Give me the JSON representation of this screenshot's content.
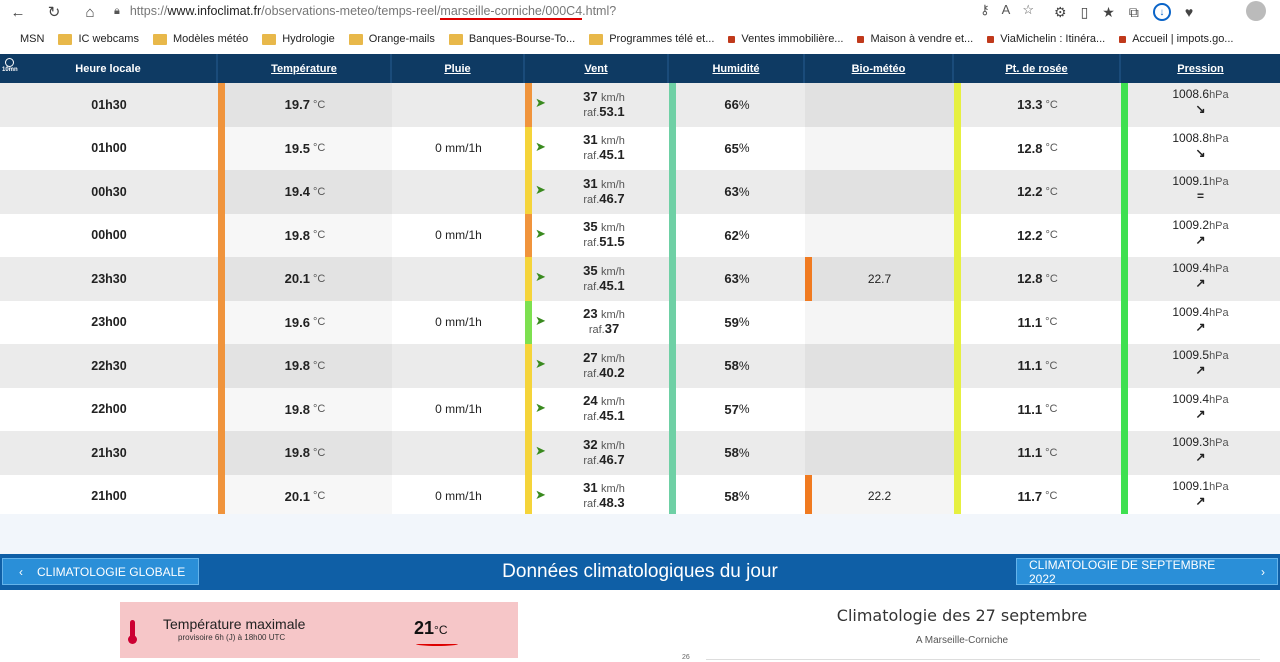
{
  "browser": {
    "url_prefix": "https://",
    "url_domain": "www.infoclimat.fr",
    "url_path": "/observations-meteo/temps-reel/",
    "url_highlight": "marseille-corniche/000C4",
    "url_suffix": ".html?"
  },
  "bookmarks": [
    {
      "label": "MSN",
      "icon": "msn-icon"
    },
    {
      "label": "IC webcams",
      "icon": "folder-icon"
    },
    {
      "label": "Modèles météo",
      "icon": "folder-icon"
    },
    {
      "label": "Hydrologie",
      "icon": "folder-icon"
    },
    {
      "label": "Orange-mails",
      "icon": "folder-icon"
    },
    {
      "label": "Banques-Bourse-To...",
      "icon": "folder-icon"
    },
    {
      "label": "Programmes télé et...",
      "icon": "folder-icon"
    },
    {
      "label": "Ventes immobilière...",
      "icon": "site-icon"
    },
    {
      "label": "Maison à vendre et...",
      "icon": "site-icon"
    },
    {
      "label": "ViaMichelin : Itinéra...",
      "icon": "site-icon"
    },
    {
      "label": "Accueil | impots.go...",
      "icon": "site-icon"
    }
  ],
  "table": {
    "interval_label": "10mn",
    "headers": {
      "time": "Heure locale",
      "temp": "Température",
      "rain": "Pluie",
      "wind": "Vent",
      "hum": "Humidité",
      "bio": "Bio-météo",
      "dew": "Pt. de rosée",
      "pres": "Pression"
    },
    "units": {
      "temp": "°C",
      "wind": "km/h",
      "pres": "hPa",
      "gust_prefix": "raf."
    },
    "rows": [
      {
        "time": "01h30",
        "temp": "19.7",
        "rain": "",
        "wind": "37",
        "gust": "53.1",
        "hum": "66",
        "bio": "",
        "dew": "13.3",
        "pres": "1008.6",
        "trend": "↘",
        "temp_color": "#f0943c",
        "wind_color": "#f0943c",
        "hum_color": "#6fd0a5",
        "bio_color": "",
        "dew_color": "#e6f040",
        "pres_color": "#3ee050"
      },
      {
        "time": "01h00",
        "temp": "19.5",
        "rain": "0 mm/1h",
        "wind": "31",
        "gust": "45.1",
        "hum": "65",
        "bio": "",
        "dew": "12.8",
        "pres": "1008.8",
        "trend": "↘",
        "temp_color": "#f0943c",
        "wind_color": "#f5d43a",
        "hum_color": "#6fd0a5",
        "bio_color": "",
        "dew_color": "#e6f040",
        "pres_color": "#3ee050"
      },
      {
        "time": "00h30",
        "temp": "19.4",
        "rain": "",
        "wind": "31",
        "gust": "46.7",
        "hum": "63",
        "bio": "",
        "dew": "12.2",
        "pres": "1009.1",
        "trend": "=",
        "temp_color": "#f0943c",
        "wind_color": "#f5d43a",
        "hum_color": "#6fd0a5",
        "bio_color": "",
        "dew_color": "#e6f040",
        "pres_color": "#3ee050"
      },
      {
        "time": "00h00",
        "temp": "19.8",
        "rain": "0 mm/1h",
        "wind": "35",
        "gust": "51.5",
        "hum": "62",
        "bio": "",
        "dew": "12.2",
        "pres": "1009.2",
        "trend": "↗",
        "temp_color": "#f0943c",
        "wind_color": "#f0943c",
        "hum_color": "#6fd0a5",
        "bio_color": "",
        "dew_color": "#e6f040",
        "pres_color": "#3ee050"
      },
      {
        "time": "23h30",
        "temp": "20.1",
        "rain": "",
        "wind": "35",
        "gust": "45.1",
        "hum": "63",
        "bio": "22.7",
        "dew": "12.8",
        "pres": "1009.4",
        "trend": "↗",
        "temp_color": "#f0943c",
        "wind_color": "#f5d43a",
        "hum_color": "#6fd0a5",
        "bio_color": "#f07a20",
        "dew_color": "#e6f040",
        "pres_color": "#3ee050"
      },
      {
        "time": "23h00",
        "temp": "19.6",
        "rain": "0 mm/1h",
        "wind": "23",
        "gust": "37",
        "hum": "59",
        "bio": "",
        "dew": "11.1",
        "pres": "1009.4",
        "trend": "↗",
        "temp_color": "#f0943c",
        "wind_color": "#7de050",
        "hum_color": "#6fd0a5",
        "bio_color": "",
        "dew_color": "#e6f040",
        "pres_color": "#3ee050"
      },
      {
        "time": "22h30",
        "temp": "19.8",
        "rain": "",
        "wind": "27",
        "gust": "40.2",
        "hum": "58",
        "bio": "",
        "dew": "11.1",
        "pres": "1009.5",
        "trend": "↗",
        "temp_color": "#f0943c",
        "wind_color": "#f5d43a",
        "hum_color": "#6fd0a5",
        "bio_color": "",
        "dew_color": "#e6f040",
        "pres_color": "#3ee050"
      },
      {
        "time": "22h00",
        "temp": "19.8",
        "rain": "0 mm/1h",
        "wind": "24",
        "gust": "45.1",
        "hum": "57",
        "bio": "",
        "dew": "11.1",
        "pres": "1009.4",
        "trend": "↗",
        "temp_color": "#f0943c",
        "wind_color": "#f5d43a",
        "hum_color": "#6fd0a5",
        "bio_color": "",
        "dew_color": "#e6f040",
        "pres_color": "#3ee050"
      },
      {
        "time": "21h30",
        "temp": "19.8",
        "rain": "",
        "wind": "32",
        "gust": "46.7",
        "hum": "58",
        "bio": "",
        "dew": "11.1",
        "pres": "1009.3",
        "trend": "↗",
        "temp_color": "#f0943c",
        "wind_color": "#f5d43a",
        "hum_color": "#6fd0a5",
        "bio_color": "",
        "dew_color": "#e6f040",
        "pres_color": "#3ee050"
      },
      {
        "time": "21h00",
        "temp": "20.1",
        "rain": "0 mm/1h",
        "wind": "31",
        "gust": "48.3",
        "hum": "58",
        "bio": "22.2",
        "dew": "11.7",
        "pres": "1009.1",
        "trend": "↗",
        "temp_color": "#f0943c",
        "wind_color": "#f5d43a",
        "hum_color": "#6fd0a5",
        "bio_color": "#f07a20",
        "dew_color": "#e6f040",
        "pres_color": "#3ee050"
      }
    ]
  },
  "climatology": {
    "left_button": "CLIMATOLOGIE GLOBALE",
    "title": "Données climatologiques du jour",
    "right_button": "CLIMATOLOGIE DE SEPTEMBRE 2022",
    "tmax_label": "Température maximale",
    "tmax_sub": "provisoire 6h (J) à 18h00 UTC",
    "tmax_value": "21",
    "tmax_unit": "°C",
    "chart_title": "Climatologie des 27 septembre",
    "chart_subtitle": "A Marseille-Corniche",
    "chart_axis_top": "26"
  }
}
